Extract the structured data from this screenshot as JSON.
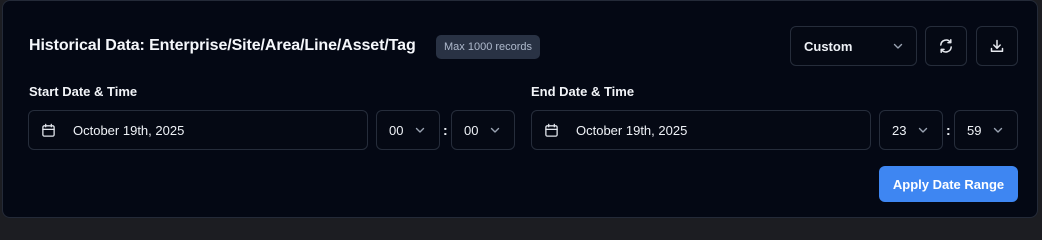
{
  "header": {
    "title": "Historical Data: Enterprise/Site/Area/Line/Asset/Tag",
    "badge": "Max 1000 records"
  },
  "range_select": {
    "value": "Custom"
  },
  "toolbar": {
    "refresh_icon": "refresh-icon",
    "download_icon": "download-icon"
  },
  "start": {
    "label": "Start Date & Time",
    "date": "October 19th, 2025",
    "hour": "00",
    "minute": "00"
  },
  "end": {
    "label": "End Date & Time",
    "date": "October 19th, 2025",
    "hour": "23",
    "minute": "59"
  },
  "time_separator": ":",
  "apply_label": "Apply Date Range",
  "colors": {
    "background": "#040814",
    "border": "#262d3b",
    "accent": "#3e86f2",
    "badge_bg": "#293244"
  }
}
